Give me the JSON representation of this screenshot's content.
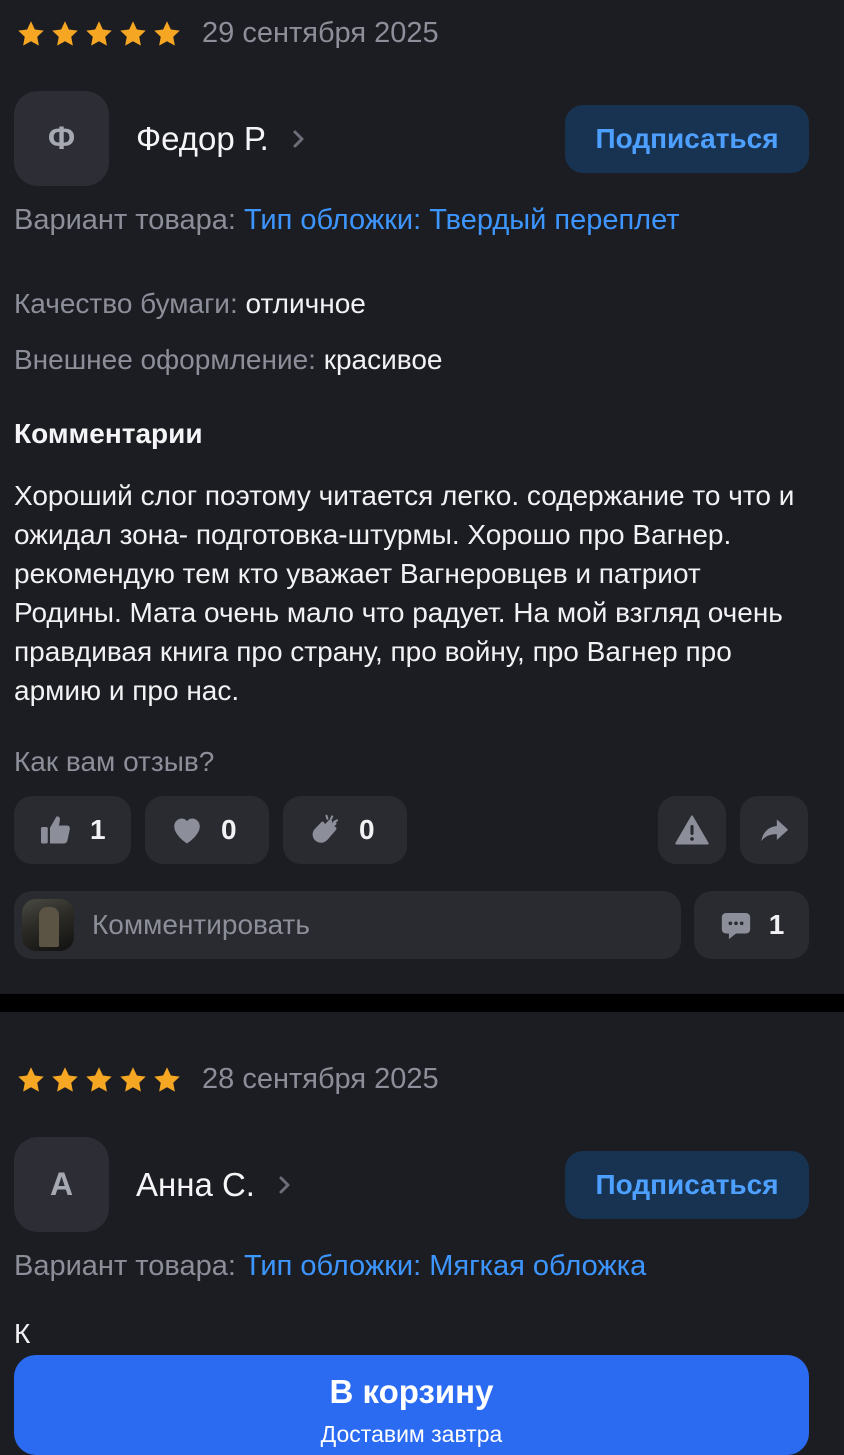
{
  "reviews": [
    {
      "rating": 5,
      "date": "29 сентября 2025",
      "author_initial": "Ф",
      "author_name": "Федор Р.",
      "subscribe_label": "Подписаться",
      "variant_label": "Вариант товара:",
      "variant_value": "Тип обложки: Твердый переплет",
      "attributes": [
        {
          "label": "Качество бумаги:",
          "value": "отличное"
        },
        {
          "label": "Внешнее оформление:",
          "value": "красивое"
        }
      ],
      "comments_title": "Комментарии",
      "comment_text": "Хороший слог поэтому читается легко. содержание то что и ожидал зона- подготовка-штурмы. Хорошо про Вагнер. рекомендую тем кто уважает Вагнеровцев и патриот Родины. Мата очень мало что радует. На мой взгляд очень правдивая книга про страну, про войну, про Вагнер про армию  и про нас.",
      "feedback_question": "Как вам отзыв?",
      "reactions": [
        {
          "icon": "thumbs-up-icon",
          "count": "1"
        },
        {
          "icon": "heart-icon",
          "count": "0"
        },
        {
          "icon": "clapping-hands-icon",
          "count": "0"
        }
      ],
      "comment_placeholder": "Комментировать",
      "comment_count": "1"
    },
    {
      "rating": 5,
      "date": "28 сентября 2025",
      "author_initial": "А",
      "author_name": "Анна С.",
      "subscribe_label": "Подписаться",
      "variant_label": "Вариант товара:",
      "variant_value": "Тип обложки: Мягкая обложка",
      "partial_text": "К"
    }
  ],
  "cart_button": {
    "label": "В корзину",
    "sublabel": "Доставим завтра"
  },
  "colors": {
    "background": "#1c1d22",
    "star": "#f5a623",
    "accent_blue": "#3d96ff",
    "cart_button": "#2b6bf2"
  }
}
